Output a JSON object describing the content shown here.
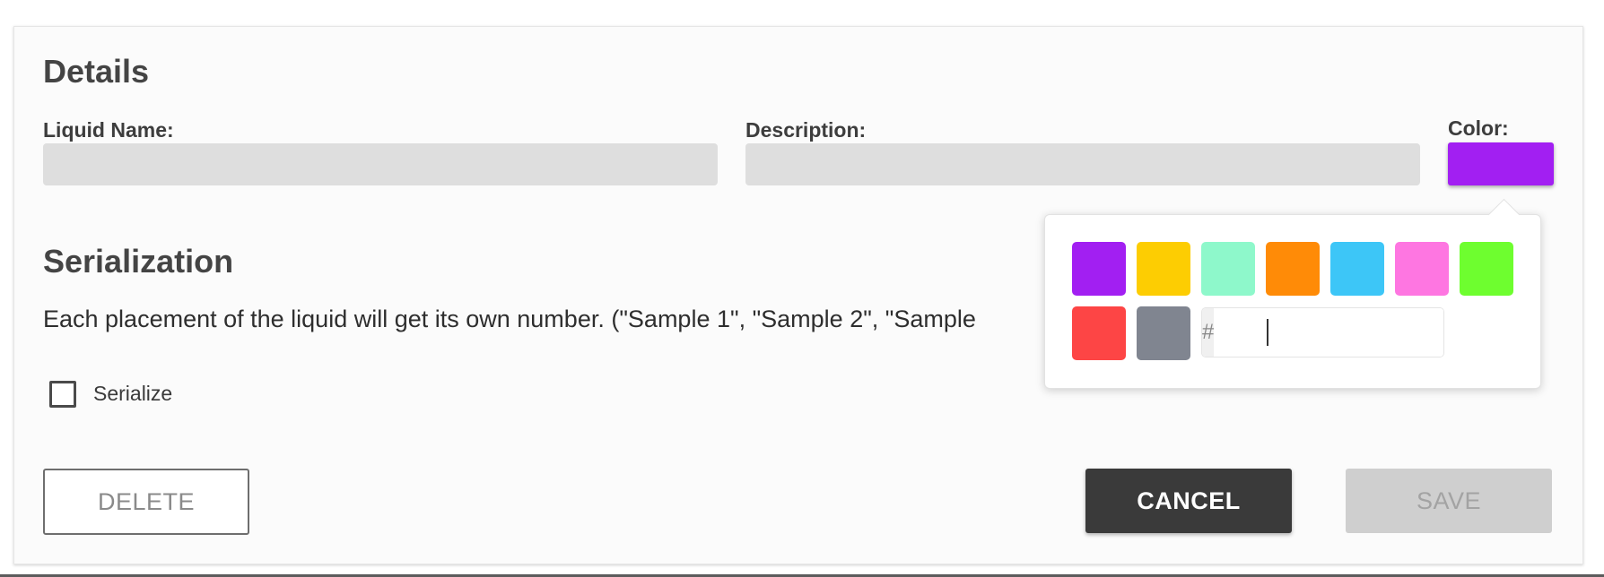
{
  "details": {
    "title": "Details",
    "liquid_name_label": "Liquid Name:",
    "liquid_name_value": "",
    "description_label": "Description:",
    "description_value": "",
    "color_label": "Color:",
    "selected_color": "#a21ff2"
  },
  "serialization": {
    "title": "Serialization",
    "description": "Each placement of the liquid will get its own number. (\"Sample 1\", \"Sample 2\", \"Sample",
    "checkbox_label": "Serialize",
    "checked": false
  },
  "color_picker": {
    "hex_prefix": "#",
    "hex_value": "",
    "swatches": [
      {
        "name": "purple",
        "color": "#a21ff2"
      },
      {
        "name": "yellow",
        "color": "#fdcd02"
      },
      {
        "name": "mint",
        "color": "#8ef8cb"
      },
      {
        "name": "orange",
        "color": "#ff8b07"
      },
      {
        "name": "sky-blue",
        "color": "#3dc6f7"
      },
      {
        "name": "pink",
        "color": "#fe76e1"
      },
      {
        "name": "green",
        "color": "#6efe2f"
      },
      {
        "name": "red",
        "color": "#fd4545"
      },
      {
        "name": "gray",
        "color": "#808590"
      }
    ]
  },
  "actions": {
    "delete_label": "DELETE",
    "cancel_label": "CANCEL",
    "save_label": "SAVE"
  }
}
